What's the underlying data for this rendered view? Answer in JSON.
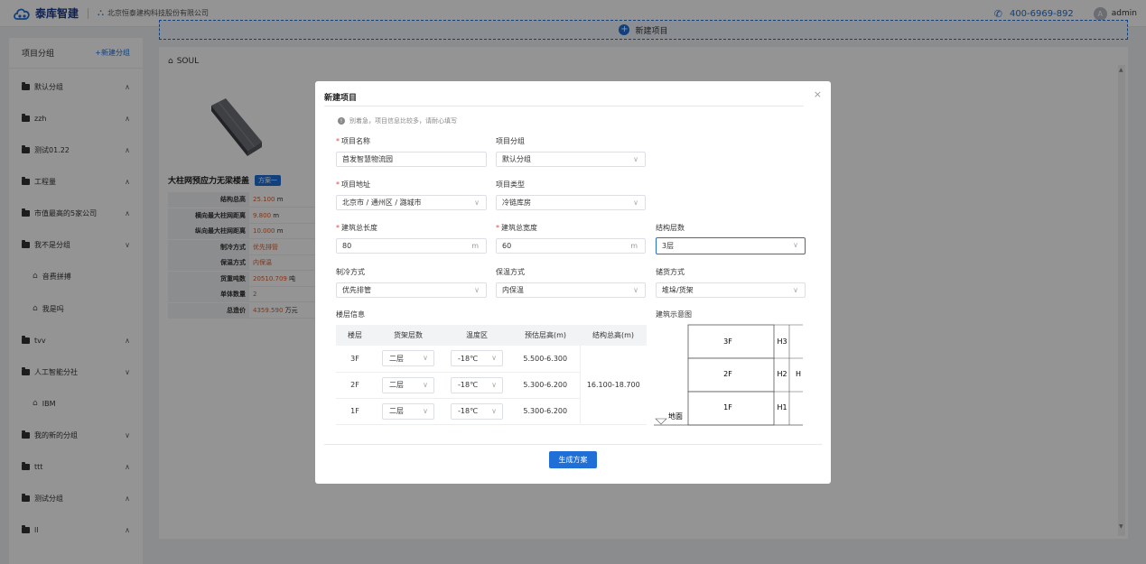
{
  "header": {
    "brand": "泰库智建",
    "company": "北京恒泰建构科技股份有限公司",
    "phone": "400-6969-892",
    "avatar_letter": "A",
    "user": "admin"
  },
  "sidebar": {
    "title": "项目分组",
    "new_group": "+新建分组",
    "items": [
      {
        "label": "默认分组",
        "chev": "^"
      },
      {
        "label": "zzh",
        "chev": "^"
      },
      {
        "label": "测试01.22",
        "chev": "^"
      },
      {
        "label": "工程量",
        "chev": "^"
      },
      {
        "label": "市值最高的5家公司",
        "chev": "^"
      },
      {
        "label": "我不是分组",
        "chev": "v"
      },
      {
        "label": "音费拼搏",
        "sub": true
      },
      {
        "label": "我是吗",
        "sub": true
      },
      {
        "label": "tvv",
        "chev": "^"
      },
      {
        "label": "人工智能分社",
        "chev": "v"
      },
      {
        "label": "IBM",
        "sub": true
      },
      {
        "label": "我的新的分组",
        "chev": "v"
      },
      {
        "label": "ttt",
        "chev": "^"
      },
      {
        "label": "测试分组",
        "chev": "^"
      },
      {
        "label": "ll",
        "chev": "^"
      }
    ]
  },
  "main": {
    "new_project": "新建项目",
    "card": {
      "title": "SOUL",
      "name": "大柱网预应力无梁楼盖",
      "tag": "方案一",
      "specs": [
        {
          "k": "结构总高",
          "v": "25.100",
          "u": " m"
        },
        {
          "k": "横向最大柱网距离",
          "v": "9.800",
          "u": " m"
        },
        {
          "k": "纵向最大柱网距离",
          "v": "10.000",
          "u": " m"
        },
        {
          "k": "制冷方式",
          "v": "优先排管",
          "u": ""
        },
        {
          "k": "保温方式",
          "v": "内保温",
          "u": ""
        },
        {
          "k": "货重吨数",
          "v": "20510.709",
          "u": " 吨"
        },
        {
          "k": "单体数量",
          "v": "2",
          "u": ""
        },
        {
          "k": "总造价",
          "v": "4359.590",
          "u": " 万元"
        }
      ]
    }
  },
  "modal": {
    "title": "新建项目",
    "close": "×",
    "hint": "别着急，项目信息比较多，请耐心填写",
    "fields": {
      "name_label": "项目名称",
      "name_value": "首发智慧物流园",
      "group_label": "项目分组",
      "group_value": "默认分组",
      "addr_label": "项目地址",
      "addr_value": "北京市 / 通州区 / 潞城市",
      "type_label": "项目类型",
      "type_value": "冷链库房",
      "length_label": "建筑总长度",
      "length_value": "80",
      "length_unit": "m",
      "width_label": "建筑总宽度",
      "width_value": "60",
      "width_unit": "m",
      "floors_label": "结构层数",
      "floors_value": "3层",
      "cool_label": "制冷方式",
      "cool_value": "优先排管",
      "insul_label": "保温方式",
      "insul_value": "内保温",
      "storage_label": "储货方式",
      "storage_value": "堆垛/货架"
    },
    "floor_info_label": "楼层信息",
    "diagram_label": "建筑示意图",
    "table": {
      "headers": [
        "楼层",
        "货架层数",
        "温度区",
        "预估层高(m)",
        "结构总高(m)"
      ],
      "rows": [
        {
          "floor": "3F",
          "shelf": "二层",
          "temp": "-18℃",
          "height": "5.500-6.300"
        },
        {
          "floor": "2F",
          "shelf": "二层",
          "temp": "-18℃",
          "height": "5.300-6.200"
        },
        {
          "floor": "1F",
          "shelf": "二层",
          "temp": "-18℃",
          "height": "5.300-6.200"
        }
      ],
      "total": "16.100-18.700"
    },
    "diagram": {
      "floors": [
        "3F",
        "2F",
        "1F"
      ],
      "heights": [
        "H3",
        "H2",
        "H1"
      ],
      "total": "H",
      "ground": "地面"
    },
    "submit": "生成方案"
  }
}
